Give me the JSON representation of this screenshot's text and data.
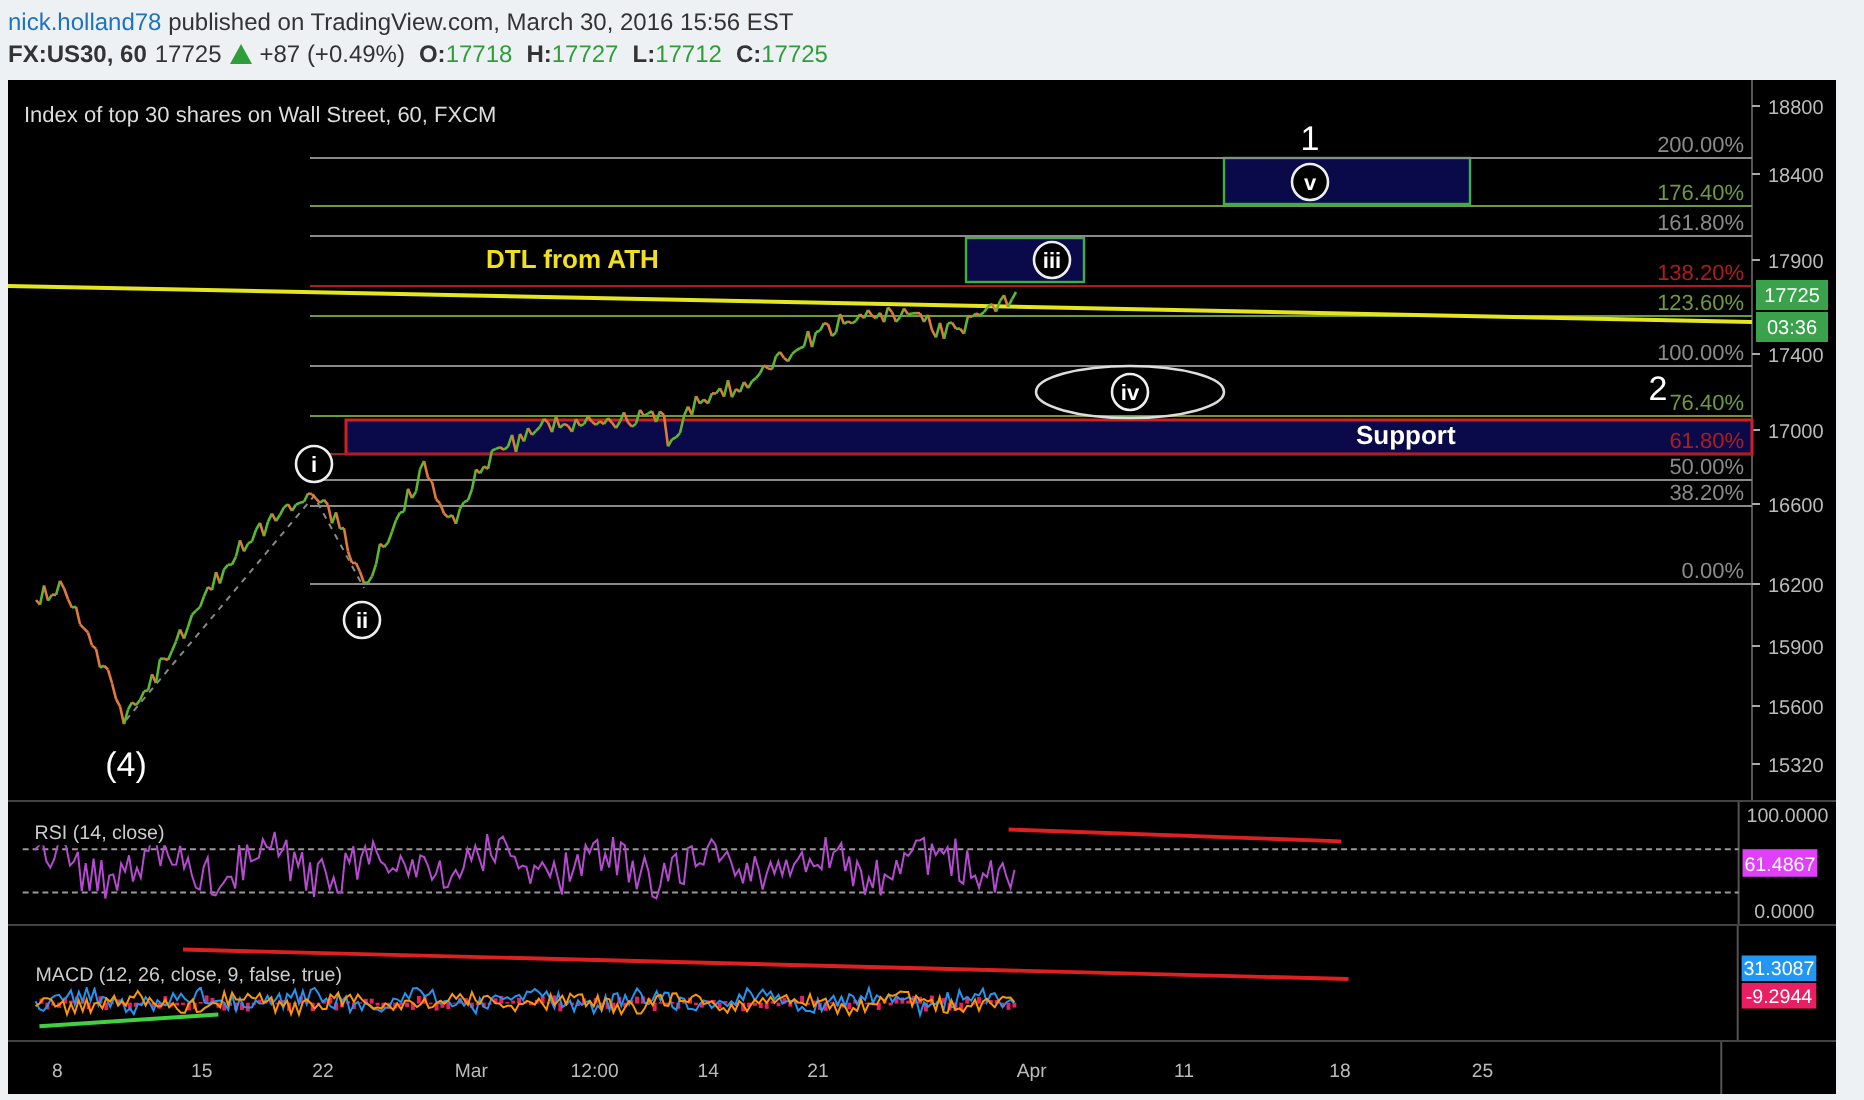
{
  "header": {
    "author": "nick.holland78",
    "published": "published on TradingView.com, March 30, 2016 15:56 EST"
  },
  "quote": {
    "symbol": "FX:US30, 60",
    "price": "17725",
    "change": "+87 (+0.49%)",
    "ohlc": [
      {
        "label": "O:",
        "value": "17718"
      },
      {
        "label": "H:",
        "value": "17727"
      },
      {
        "label": "L:",
        "value": "17712"
      },
      {
        "label": "C:",
        "value": "17725"
      }
    ]
  },
  "chart": {
    "title": "Index of top 30 shares on Wall Street, 60, FXCM",
    "price_axis": [
      "18800",
      "18400",
      "17900",
      "17400",
      "17000",
      "16600",
      "16200",
      "15900",
      "15600",
      "15320"
    ],
    "last_price": "17725",
    "countdown": "03:36",
    "fib_levels": [
      {
        "label": "200.00%",
        "color": "#8a8a8a"
      },
      {
        "label": "176.40%",
        "color": "#6f9a3c"
      },
      {
        "label": "161.80%",
        "color": "#8a8a8a"
      },
      {
        "label": "138.20%",
        "color": "#b01c1c"
      },
      {
        "label": "123.60%",
        "color": "#6f9a3c"
      },
      {
        "label": "100.00%",
        "color": "#8a8a8a"
      },
      {
        "label": "76.40%",
        "color": "#6f9a3c"
      },
      {
        "label": "61.80%",
        "color": "#b01c1c"
      },
      {
        "label": "50.00%",
        "color": "#8a8a8a"
      },
      {
        "label": "38.20%",
        "color": "#8a8a8a"
      },
      {
        "label": "0.00%",
        "color": "#8a8a8a"
      }
    ],
    "wave_labels": [
      "1",
      "2",
      "(4)"
    ],
    "circled_labels": [
      "i",
      "ii",
      "iii",
      "iv",
      "v"
    ],
    "trendline_label": "DTL from ATH",
    "zone_label": "Support"
  },
  "rsi": {
    "title": "RSI (14, close)",
    "axis": [
      "100.0000",
      "0.0000"
    ],
    "value": "61.4867"
  },
  "macd": {
    "title": "MACD (12, 26, close, 9, false, true)",
    "values": [
      {
        "label": "31.3087",
        "color": "#2196f3"
      },
      {
        "label": "-9.2944",
        "color": "#e91e63"
      }
    ]
  },
  "time_axis": [
    "8",
    "15",
    "22",
    "Mar",
    "12:00",
    "14",
    "21",
    "Apr",
    "11",
    "18",
    "25"
  ]
}
